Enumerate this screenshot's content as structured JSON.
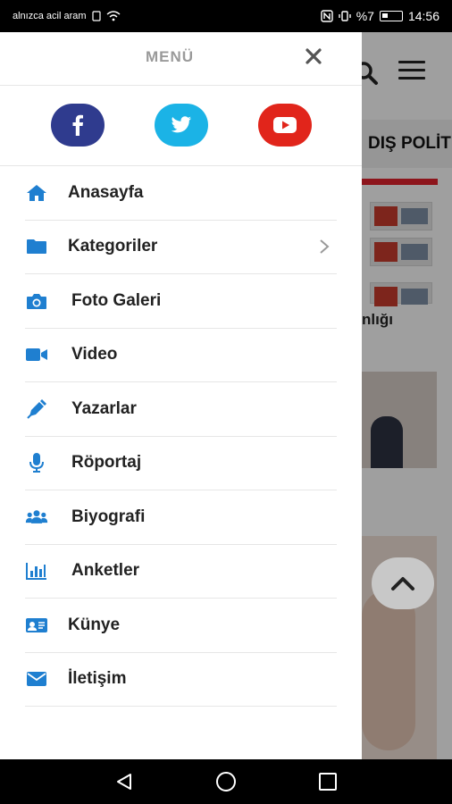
{
  "status_bar": {
    "carrier": "alnızca acil aram",
    "battery_percent": "%7",
    "time": "14:56"
  },
  "background_page": {
    "category_label": "DIŞ POLİT",
    "headline_fragment": "nlığı"
  },
  "drawer": {
    "title": "MENÜ",
    "social": [
      {
        "name": "facebook",
        "glyph": "f",
        "color": "#2f3b8e"
      },
      {
        "name": "twitter",
        "glyph": "t",
        "color": "#1bb3e6"
      },
      {
        "name": "youtube",
        "glyph": "▶",
        "color": "#e1251b"
      }
    ],
    "items": [
      {
        "label": "Anasayfa",
        "icon": "home-icon"
      },
      {
        "label": "Kategoriler",
        "icon": "folder-icon",
        "has_submenu": true
      },
      {
        "label": "Foto Galeri",
        "icon": "camera-icon"
      },
      {
        "label": "Video",
        "icon": "video-camera-icon"
      },
      {
        "label": "Yazarlar",
        "icon": "pen-icon"
      },
      {
        "label": "Röportaj",
        "icon": "microphone-icon"
      },
      {
        "label": "Biyografi",
        "icon": "users-icon"
      },
      {
        "label": "Anketler",
        "icon": "bar-chart-icon"
      },
      {
        "label": "Künye",
        "icon": "id-card-icon"
      },
      {
        "label": "İletişim",
        "icon": "envelope-icon"
      }
    ]
  },
  "colors": {
    "accent_blue": "#1f7fd0",
    "menu_text": "#222222",
    "title_gray": "#9a9a9a",
    "category_red": "#d9212c"
  }
}
